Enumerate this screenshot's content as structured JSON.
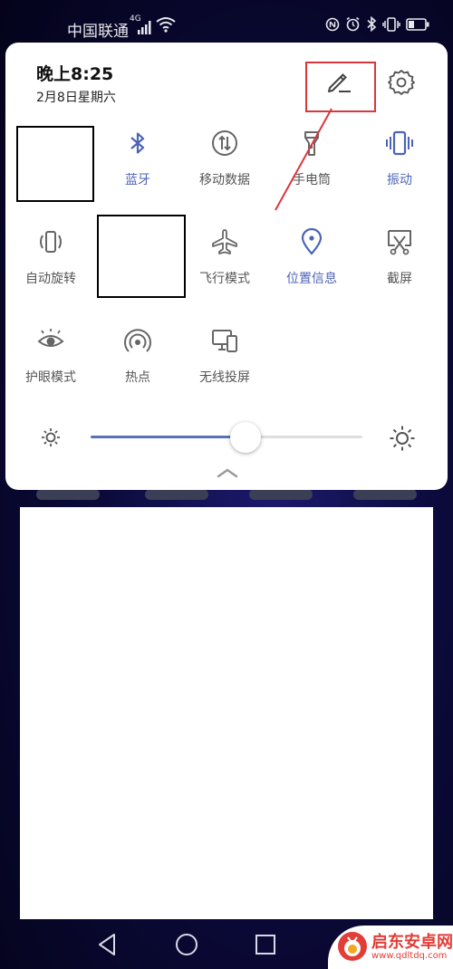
{
  "status_bar": {
    "carrier": "中国联通",
    "network_type": "4G",
    "icons": [
      "signal-icon",
      "wifi-icon",
      "nfc-icon",
      "alarm-icon",
      "bluetooth-icon",
      "vibrate-icon",
      "battery-icon"
    ]
  },
  "panel": {
    "time": "晚上8:25",
    "date": "2月8日星期六",
    "edit_icon": "pencil-icon",
    "settings_icon": "gear-icon"
  },
  "tiles": [
    {
      "label": "",
      "icon": "redacted",
      "active": false
    },
    {
      "label": "蓝牙",
      "icon": "bluetooth-icon",
      "active": true
    },
    {
      "label": "移动数据",
      "icon": "mobile-data-icon",
      "active": false
    },
    {
      "label": "手电筒",
      "icon": "flashlight-icon",
      "active": false
    },
    {
      "label": "振动",
      "icon": "vibrate-icon",
      "active": true
    },
    {
      "label": "自动旋转",
      "icon": "auto-rotate-icon",
      "active": false
    },
    {
      "label": "",
      "icon": "redacted",
      "active": false
    },
    {
      "label": "飞行模式",
      "icon": "airplane-icon",
      "active": false
    },
    {
      "label": "位置信息",
      "icon": "location-icon",
      "active": true
    },
    {
      "label": "截屏",
      "icon": "screenshot-icon",
      "active": false
    },
    {
      "label": "护眼模式",
      "icon": "eye-icon",
      "active": false
    },
    {
      "label": "热点",
      "icon": "hotspot-icon",
      "active": false
    },
    {
      "label": "无线投屏",
      "icon": "wireless-projection-icon",
      "active": false
    }
  ],
  "brightness": {
    "level": 0.57
  },
  "colors": {
    "accent": "#4d64b5",
    "highlight": "#d9363e",
    "wallpaper": "#0b0a3a"
  },
  "navigation": {
    "icons": [
      "back-icon",
      "home-icon",
      "recents-icon"
    ]
  },
  "watermark": {
    "name": "启东安卓网",
    "url": "www.qdltdq.com"
  }
}
